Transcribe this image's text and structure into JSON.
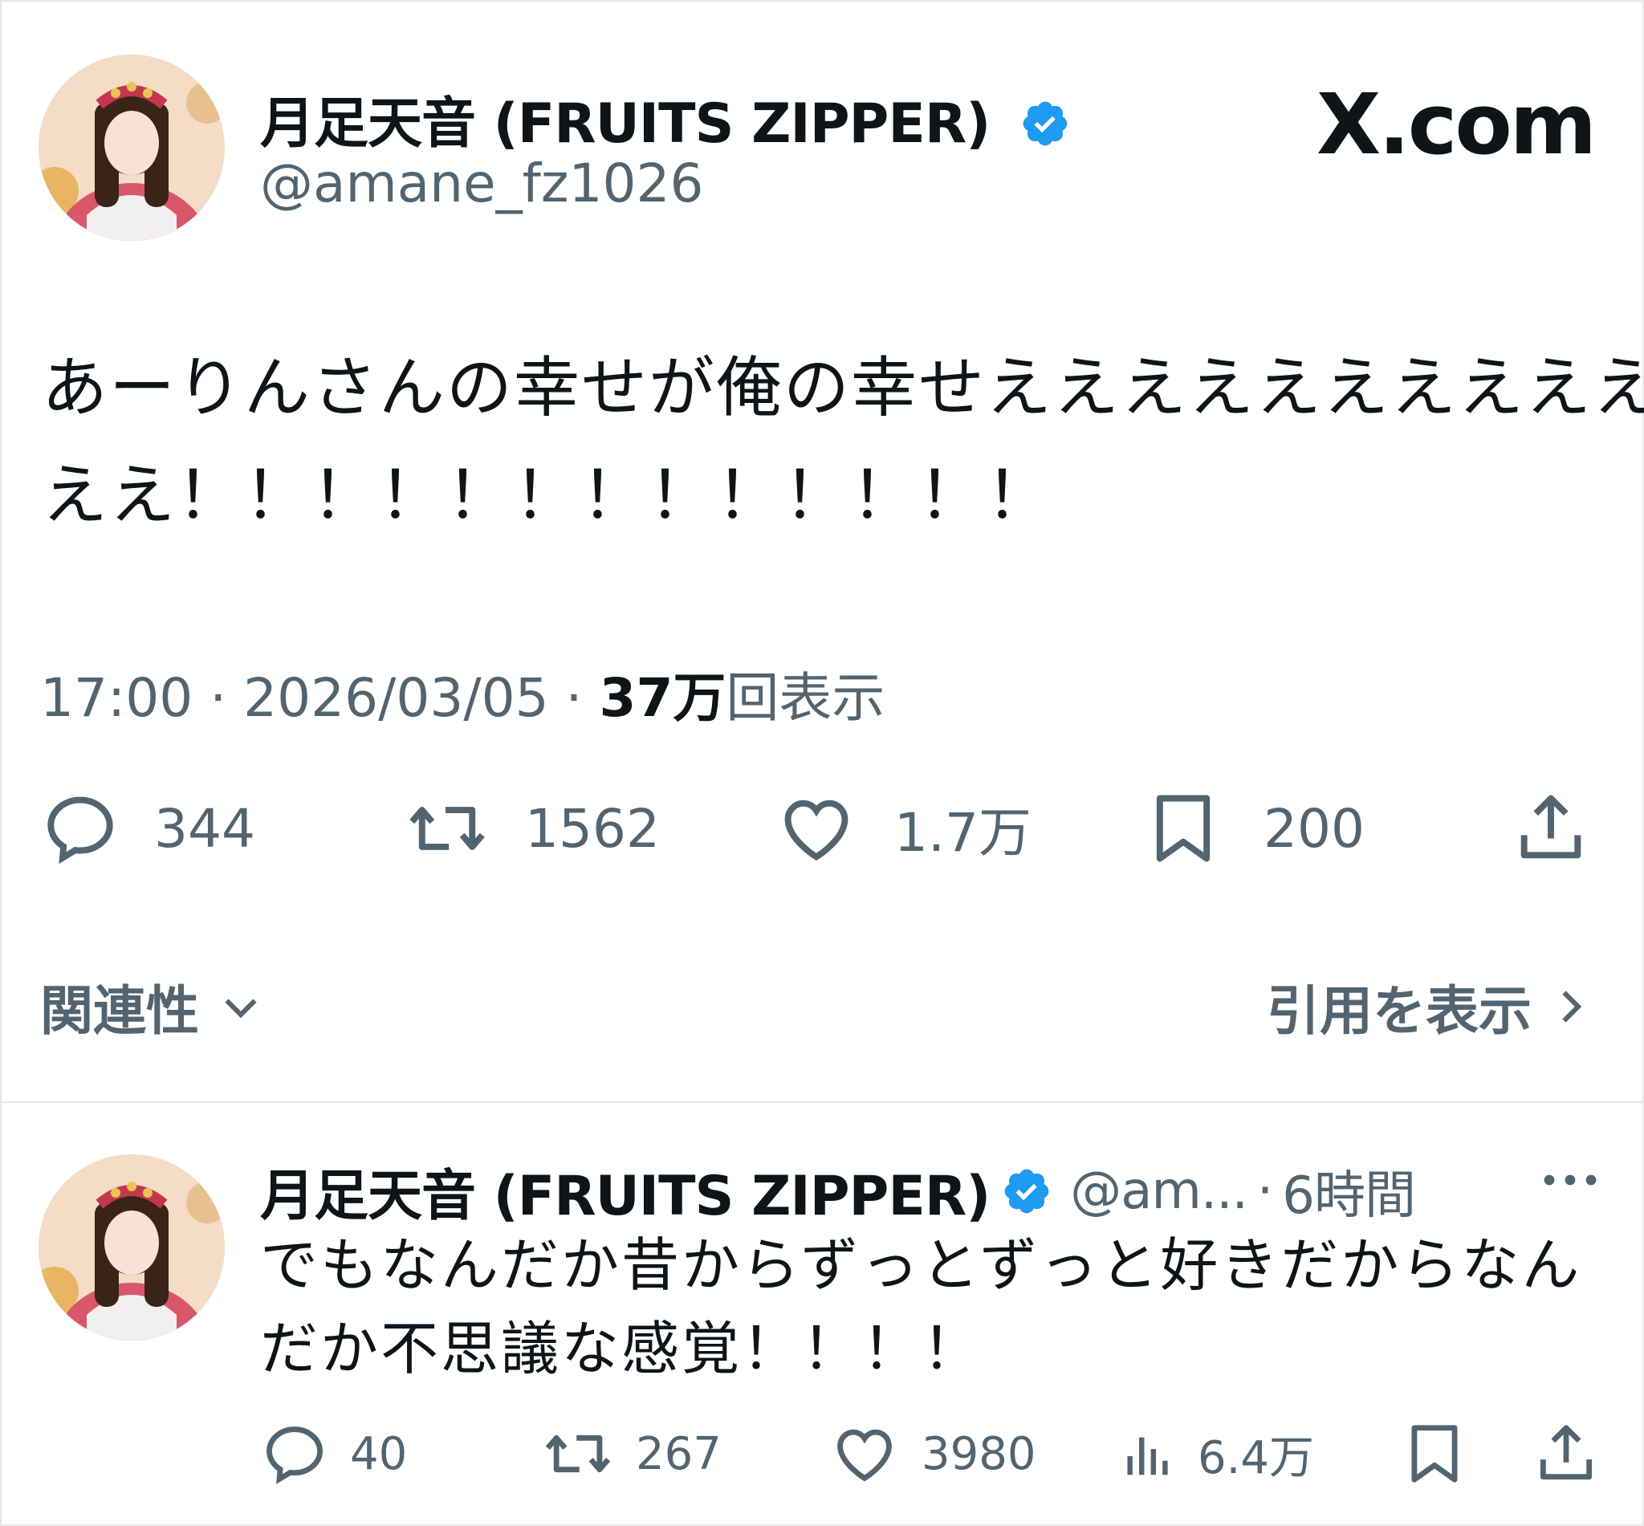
{
  "site_logo": "X.com",
  "colors": {
    "verified": "#1d9bf0",
    "secondary_text": "#536471",
    "primary_text": "#0f1419"
  },
  "main_post": {
    "display_name": "月足天音 (FRUITS ZIPPER)",
    "handle": "@amane_fz1026",
    "text_line1": "あーりんさんの幸せが俺の幸せええええええええええ",
    "text_line2": "ええ！！！！！！！！！！！！！",
    "time": "17:00",
    "date": "2026/03/05",
    "views_count": "37万",
    "views_label": "回表示",
    "separator": "·",
    "stats": {
      "replies": "344",
      "reposts": "1562",
      "likes": "1.7万",
      "bookmarks": "200"
    },
    "relevance_label": "関連性",
    "quotes_label": "引用を表示"
  },
  "reply_post": {
    "display_name": "月足天音 (FRUITS ZIPPER)",
    "handle_truncated": "@am...",
    "time_ago": "6時間",
    "separator": "·",
    "text_line1": "でもなんだか昔からずっとずっと好きだからなん",
    "text_line2": "だか不思議な感覚！！！！",
    "stats": {
      "replies": "40",
      "reposts": "267",
      "likes": "3980",
      "views": "6.4万"
    }
  }
}
